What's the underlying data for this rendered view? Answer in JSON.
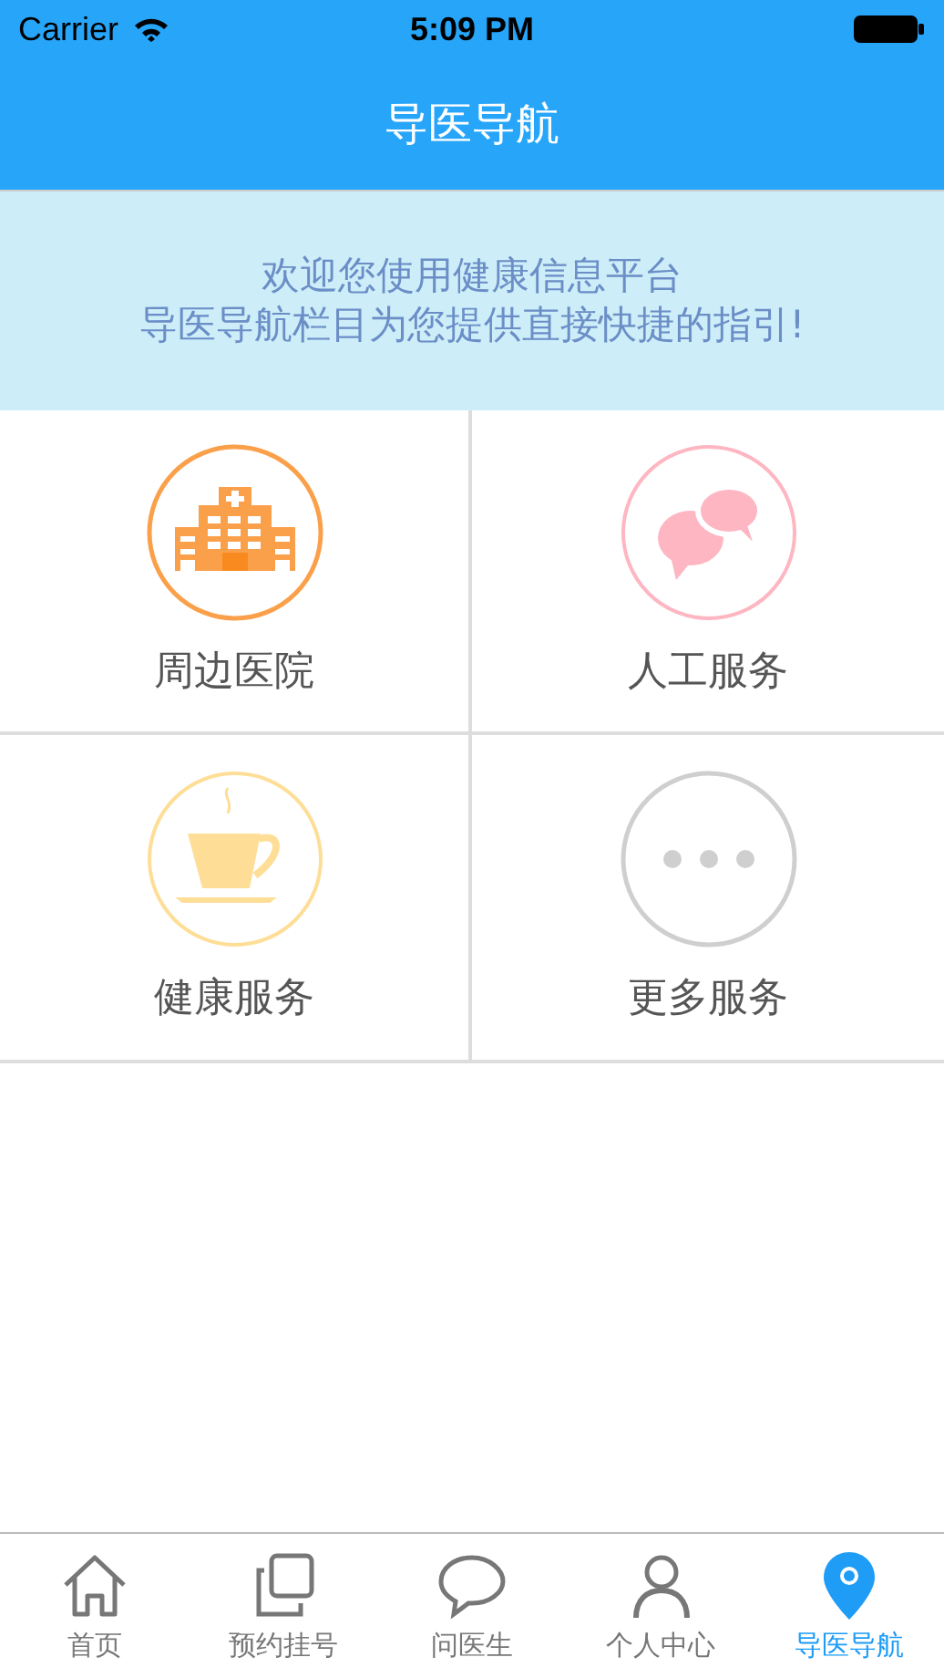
{
  "status_bar": {
    "carrier": "Carrier",
    "time": "5:09 PM"
  },
  "nav": {
    "title": "导医导航"
  },
  "banner": {
    "lines": [
      "欢迎您使用健康信息平台",
      "导医导航栏目为您提供直接快捷的指引!"
    ]
  },
  "tiles": [
    {
      "kind": "hospital",
      "label": "周边医院"
    },
    {
      "kind": "chat",
      "label": "人工服务"
    },
    {
      "kind": "cup",
      "label": "健康服务"
    },
    {
      "kind": "more",
      "label": "更多服务"
    }
  ],
  "tab_bar": [
    {
      "kind": "home",
      "label": "首页",
      "selected": false
    },
    {
      "kind": "pages",
      "label": "预约挂号",
      "selected": false
    },
    {
      "kind": "bubble",
      "label": "问医生",
      "selected": false
    },
    {
      "kind": "person",
      "label": "个人中心",
      "selected": false
    },
    {
      "kind": "pin",
      "label": "导医导航",
      "selected": true
    }
  ]
}
